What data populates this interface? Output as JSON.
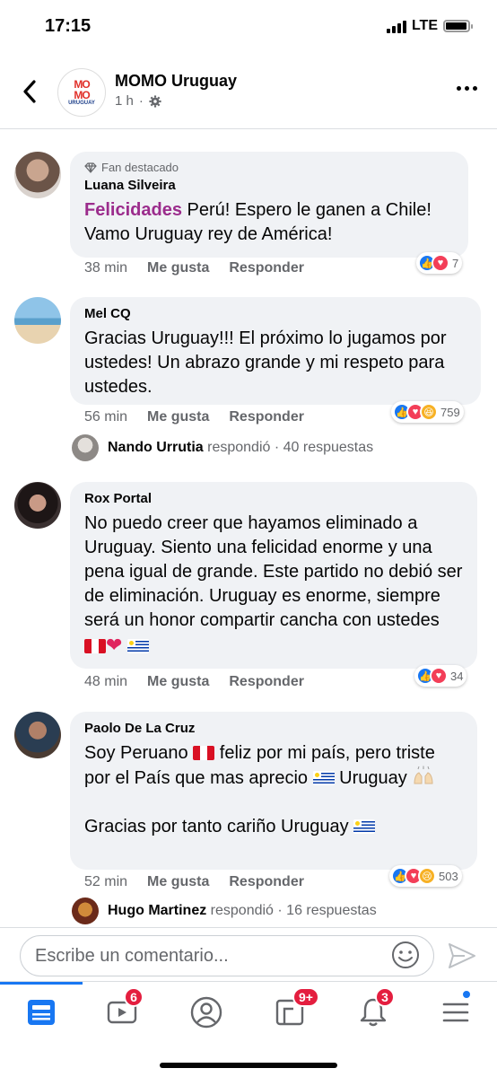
{
  "status": {
    "time": "17:15",
    "network": "LTE",
    "battery_level": 0.95
  },
  "header": {
    "page_name": "MOMO Uruguay",
    "time_ago": "1 h",
    "logo": {
      "line1": "MO",
      "line2": "MO",
      "sub": "URUGUAY"
    },
    "icons": {
      "back": "chevron-left-icon",
      "privacy": "gear-icon",
      "more": "more-horizontal-icon"
    }
  },
  "comments": [
    {
      "badge": "Fan destacado",
      "author": "Luana Silveira",
      "text_highlight": "Felicidades",
      "text_rest": " Perú! Espero le ganen a Chile! Vamo Uruguay rey de América!",
      "time": "38 min",
      "like_label": "Me gusta",
      "reply_label": "Responder",
      "reaction_count": "7",
      "reactions": [
        "like",
        "love"
      ]
    },
    {
      "author": "Mel CQ",
      "text": "Gracias Uruguay!!! El próximo lo jugamos por ustedes! Un abrazo grande y mi respeto para ustedes.",
      "time": "56 min",
      "like_label": "Me gusta",
      "reply_label": "Responder",
      "reaction_count": "759",
      "reactions": [
        "like",
        "love",
        "haha"
      ],
      "reply_summary": {
        "name": "Nando Urrutia",
        "action": "respondió",
        "count": "· 40 respuestas"
      }
    },
    {
      "author": "Rox Portal",
      "text": "No puedo creer que hayamos eliminado a Uruguay. Siento una felicidad enorme y una pena igual de grande. Este partido no debió ser de eliminación. Uruguay es enorme, siempre será un honor compartir cancha con ustedes",
      "time": "48 min",
      "like_label": "Me gusta",
      "reply_label": "Responder",
      "reaction_count": "34",
      "reactions": [
        "like",
        "love"
      ]
    },
    {
      "author": "Paolo De La Cruz",
      "text_p1": "Soy Peruano",
      "text_p2": " feliz por mi país, pero triste por el País que mas aprecio",
      "text_p3": " Uruguay",
      "text_p4": "Gracias por tanto cariño Uruguay",
      "time": "52 min",
      "like_label": "Me gusta",
      "reply_label": "Responder",
      "reaction_count": "503",
      "reactions": [
        "like",
        "love",
        "sad"
      ],
      "reply_summary": {
        "name": "Hugo Martinez",
        "action": "respondió",
        "count": "· 16 respuestas"
      }
    }
  ],
  "composer": {
    "placeholder": "Escribe un comentario...",
    "icons": {
      "emoji": "smiley-icon",
      "send": "send-icon"
    }
  },
  "tabbar": {
    "tabs": [
      {
        "name": "feed",
        "icon": "news-feed-icon",
        "badge": ""
      },
      {
        "name": "watch",
        "icon": "watch-video-icon",
        "badge": "6"
      },
      {
        "name": "profile",
        "icon": "profile-icon",
        "badge": ""
      },
      {
        "name": "pages",
        "icon": "pages-icon",
        "badge": "9+"
      },
      {
        "name": "notifications",
        "icon": "bell-icon",
        "badge": "3"
      },
      {
        "name": "menu",
        "icon": "menu-icon",
        "badge": ""
      }
    ]
  },
  "colors": {
    "accent": "#1877f2",
    "highlight_text": "#9b2c8c",
    "bubble_bg": "#f0f2f5",
    "badge_red": "#e41e3f"
  }
}
